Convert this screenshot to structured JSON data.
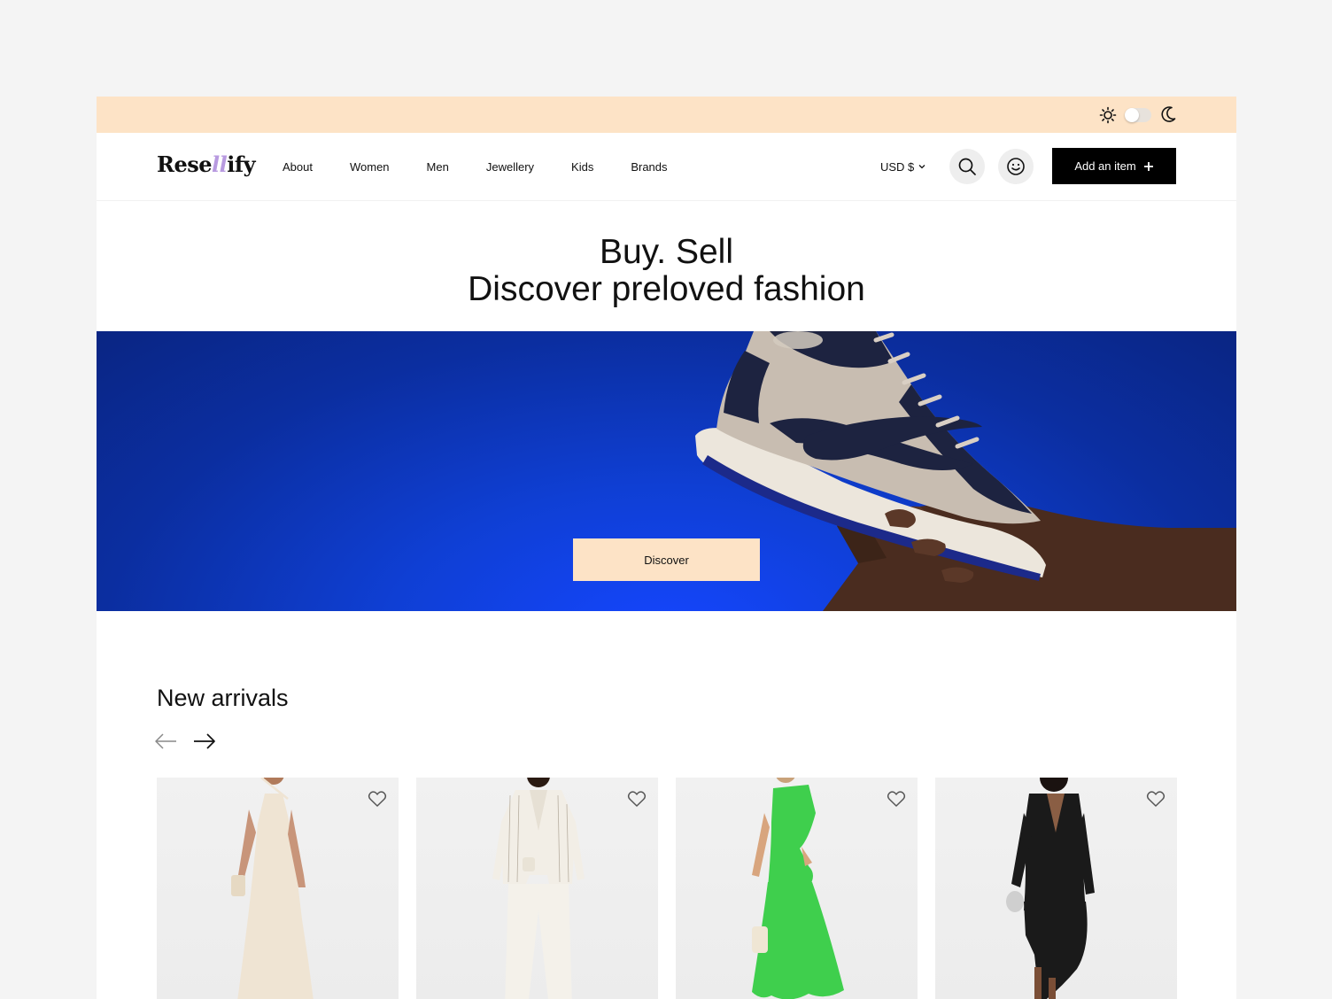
{
  "brand": {
    "logo_pre": "Rese",
    "logo_accent": "ll",
    "logo_post": "ify"
  },
  "topbar": {
    "theme_light_icon": "sun-icon",
    "theme_dark_icon": "moon-icon",
    "theme_mode": "light"
  },
  "nav": {
    "links": [
      "About",
      "Women",
      "Men",
      "Jewellery",
      "Kids",
      "Brands"
    ],
    "currency": "USD $",
    "add_item_label": "Add an item"
  },
  "hero": {
    "line1": "Buy. Sell",
    "line2": "Discover preloved fashion",
    "cta_label": "Discover"
  },
  "new_arrivals": {
    "title": "New arrivals",
    "products": [
      {
        "color": "#efe4d3"
      },
      {
        "color": "#f2eee6"
      },
      {
        "color": "#3fcf4d"
      },
      {
        "color": "#1a1a1a"
      }
    ]
  },
  "colors": {
    "accent_peach": "#fde3c6",
    "hero_blue": "#0f3fd4",
    "logo_accent": "#b89ae0",
    "primary_button": "#000000"
  }
}
